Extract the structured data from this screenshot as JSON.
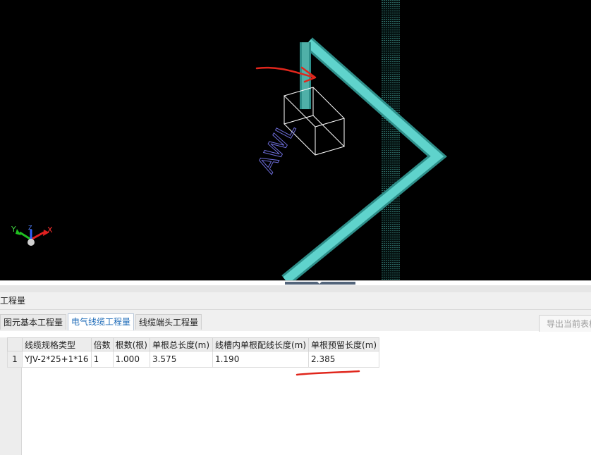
{
  "viewport": {
    "label_text": "AWL",
    "axis": {
      "x": "X",
      "y": "Y",
      "z": "Z"
    }
  },
  "panel": {
    "title": "工程量",
    "tabs": [
      {
        "label": "图元基本工程量",
        "active": false
      },
      {
        "label": "电气线缆工程量",
        "active": true
      },
      {
        "label": "线缆端头工程量",
        "active": false
      }
    ],
    "export_label": "导出当前表格"
  },
  "table": {
    "columns": [
      "线缆规格类型",
      "倍数",
      "根数(根)",
      "单根总长度(m)",
      "线槽内单根配线长度(m)",
      "单根预留长度(m)"
    ],
    "rows": [
      {
        "num": "1",
        "cells": [
          "YJV-2*25+1*16",
          "1",
          "1.000",
          "3.575",
          "1.190",
          "2.385"
        ]
      }
    ]
  },
  "colors": {
    "pipe": "#5fd3cc",
    "annotation": "#e0261c",
    "label": "#6b6bd6",
    "active_tab": "#1e6bb8"
  }
}
